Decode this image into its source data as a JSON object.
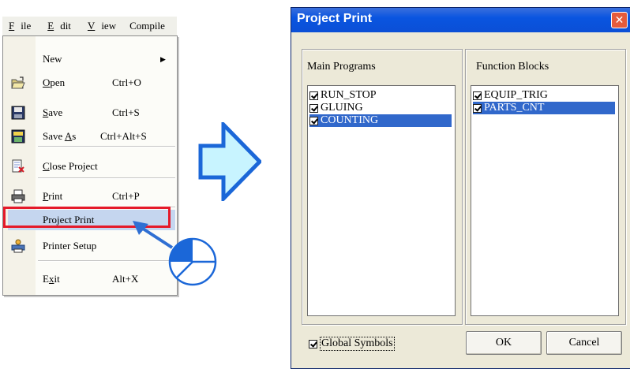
{
  "menubar": {
    "items": [
      {
        "label": "File"
      },
      {
        "label": "Edit"
      },
      {
        "label": "View"
      },
      {
        "label": "Compile"
      }
    ]
  },
  "menu": {
    "items": [
      {
        "label": "New",
        "shortcut": "",
        "icon": "none",
        "submenu": true
      },
      {
        "label": "Open",
        "shortcut": "Ctrl+O",
        "icon": "open-folder-icon"
      },
      {
        "label": "Save",
        "shortcut": "Ctrl+S",
        "icon": "floppy-disk-icon"
      },
      {
        "label": "Save As",
        "shortcut": "Ctrl+Alt+S",
        "icon": "save-as-icon"
      },
      {
        "label": "Close Project",
        "shortcut": "",
        "icon": "close-project-icon"
      },
      {
        "label": "Print",
        "shortcut": "Ctrl+P",
        "icon": "printer-icon"
      },
      {
        "label": "Project Print",
        "shortcut": "",
        "icon": "none",
        "highlighted": true
      },
      {
        "label": "Printer Setup",
        "shortcut": "",
        "icon": "printer-setup-icon"
      },
      {
        "label": "Exit",
        "shortcut": "Alt+X",
        "icon": "none"
      }
    ]
  },
  "dialog": {
    "title": "Project Print",
    "close_glyph": "✕",
    "main_programs": {
      "label": "Main Programs",
      "items": [
        {
          "label": "RUN_STOP",
          "checked": true,
          "selected": false
        },
        {
          "label": "GLUING",
          "checked": true,
          "selected": false
        },
        {
          "label": "COUNTING",
          "checked": true,
          "selected": true
        }
      ]
    },
    "function_blocks": {
      "label": "Function Blocks",
      "items": [
        {
          "label": "EQUIP_TRIG",
          "checked": true,
          "selected": false
        },
        {
          "label": "PARTS_CNT",
          "checked": true,
          "selected": true
        }
      ]
    },
    "global_symbols": {
      "label": "Global Symbols",
      "checked": true
    },
    "ok_label": "OK",
    "cancel_label": "Cancel"
  },
  "colors": {
    "selection": "#3168cb",
    "menu_highlight": "#c5d6ef",
    "callout_red": "#e51a2a",
    "arrow_cyan": "#c8f4ff",
    "arrow_blue": "#1b67d8"
  }
}
